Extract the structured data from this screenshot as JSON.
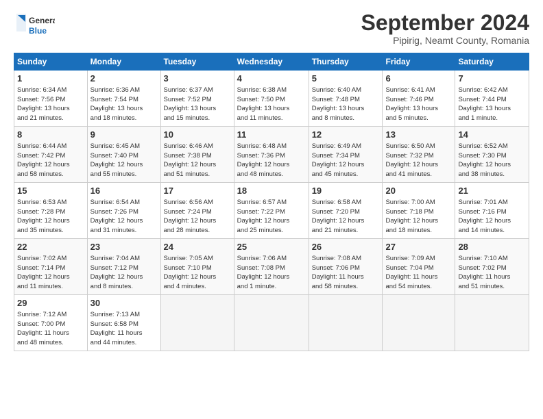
{
  "header": {
    "logo_line1": "General",
    "logo_line2": "Blue",
    "month": "September 2024",
    "location": "Pipirig, Neamt County, Romania"
  },
  "weekdays": [
    "Sunday",
    "Monday",
    "Tuesday",
    "Wednesday",
    "Thursday",
    "Friday",
    "Saturday"
  ],
  "weeks": [
    [
      {
        "day": "1",
        "info": "Sunrise: 6:34 AM\nSunset: 7:56 PM\nDaylight: 13 hours\nand 21 minutes."
      },
      {
        "day": "2",
        "info": "Sunrise: 6:36 AM\nSunset: 7:54 PM\nDaylight: 13 hours\nand 18 minutes."
      },
      {
        "day": "3",
        "info": "Sunrise: 6:37 AM\nSunset: 7:52 PM\nDaylight: 13 hours\nand 15 minutes."
      },
      {
        "day": "4",
        "info": "Sunrise: 6:38 AM\nSunset: 7:50 PM\nDaylight: 13 hours\nand 11 minutes."
      },
      {
        "day": "5",
        "info": "Sunrise: 6:40 AM\nSunset: 7:48 PM\nDaylight: 13 hours\nand 8 minutes."
      },
      {
        "day": "6",
        "info": "Sunrise: 6:41 AM\nSunset: 7:46 PM\nDaylight: 13 hours\nand 5 minutes."
      },
      {
        "day": "7",
        "info": "Sunrise: 6:42 AM\nSunset: 7:44 PM\nDaylight: 13 hours\nand 1 minute."
      }
    ],
    [
      {
        "day": "8",
        "info": "Sunrise: 6:44 AM\nSunset: 7:42 PM\nDaylight: 12 hours\nand 58 minutes."
      },
      {
        "day": "9",
        "info": "Sunrise: 6:45 AM\nSunset: 7:40 PM\nDaylight: 12 hours\nand 55 minutes."
      },
      {
        "day": "10",
        "info": "Sunrise: 6:46 AM\nSunset: 7:38 PM\nDaylight: 12 hours\nand 51 minutes."
      },
      {
        "day": "11",
        "info": "Sunrise: 6:48 AM\nSunset: 7:36 PM\nDaylight: 12 hours\nand 48 minutes."
      },
      {
        "day": "12",
        "info": "Sunrise: 6:49 AM\nSunset: 7:34 PM\nDaylight: 12 hours\nand 45 minutes."
      },
      {
        "day": "13",
        "info": "Sunrise: 6:50 AM\nSunset: 7:32 PM\nDaylight: 12 hours\nand 41 minutes."
      },
      {
        "day": "14",
        "info": "Sunrise: 6:52 AM\nSunset: 7:30 PM\nDaylight: 12 hours\nand 38 minutes."
      }
    ],
    [
      {
        "day": "15",
        "info": "Sunrise: 6:53 AM\nSunset: 7:28 PM\nDaylight: 12 hours\nand 35 minutes."
      },
      {
        "day": "16",
        "info": "Sunrise: 6:54 AM\nSunset: 7:26 PM\nDaylight: 12 hours\nand 31 minutes."
      },
      {
        "day": "17",
        "info": "Sunrise: 6:56 AM\nSunset: 7:24 PM\nDaylight: 12 hours\nand 28 minutes."
      },
      {
        "day": "18",
        "info": "Sunrise: 6:57 AM\nSunset: 7:22 PM\nDaylight: 12 hours\nand 25 minutes."
      },
      {
        "day": "19",
        "info": "Sunrise: 6:58 AM\nSunset: 7:20 PM\nDaylight: 12 hours\nand 21 minutes."
      },
      {
        "day": "20",
        "info": "Sunrise: 7:00 AM\nSunset: 7:18 PM\nDaylight: 12 hours\nand 18 minutes."
      },
      {
        "day": "21",
        "info": "Sunrise: 7:01 AM\nSunset: 7:16 PM\nDaylight: 12 hours\nand 14 minutes."
      }
    ],
    [
      {
        "day": "22",
        "info": "Sunrise: 7:02 AM\nSunset: 7:14 PM\nDaylight: 12 hours\nand 11 minutes."
      },
      {
        "day": "23",
        "info": "Sunrise: 7:04 AM\nSunset: 7:12 PM\nDaylight: 12 hours\nand 8 minutes."
      },
      {
        "day": "24",
        "info": "Sunrise: 7:05 AM\nSunset: 7:10 PM\nDaylight: 12 hours\nand 4 minutes."
      },
      {
        "day": "25",
        "info": "Sunrise: 7:06 AM\nSunset: 7:08 PM\nDaylight: 12 hours\nand 1 minute."
      },
      {
        "day": "26",
        "info": "Sunrise: 7:08 AM\nSunset: 7:06 PM\nDaylight: 11 hours\nand 58 minutes."
      },
      {
        "day": "27",
        "info": "Sunrise: 7:09 AM\nSunset: 7:04 PM\nDaylight: 11 hours\nand 54 minutes."
      },
      {
        "day": "28",
        "info": "Sunrise: 7:10 AM\nSunset: 7:02 PM\nDaylight: 11 hours\nand 51 minutes."
      }
    ],
    [
      {
        "day": "29",
        "info": "Sunrise: 7:12 AM\nSunset: 7:00 PM\nDaylight: 11 hours\nand 48 minutes."
      },
      {
        "day": "30",
        "info": "Sunrise: 7:13 AM\nSunset: 6:58 PM\nDaylight: 11 hours\nand 44 minutes."
      },
      {
        "day": "",
        "info": ""
      },
      {
        "day": "",
        "info": ""
      },
      {
        "day": "",
        "info": ""
      },
      {
        "day": "",
        "info": ""
      },
      {
        "day": "",
        "info": ""
      }
    ]
  ]
}
